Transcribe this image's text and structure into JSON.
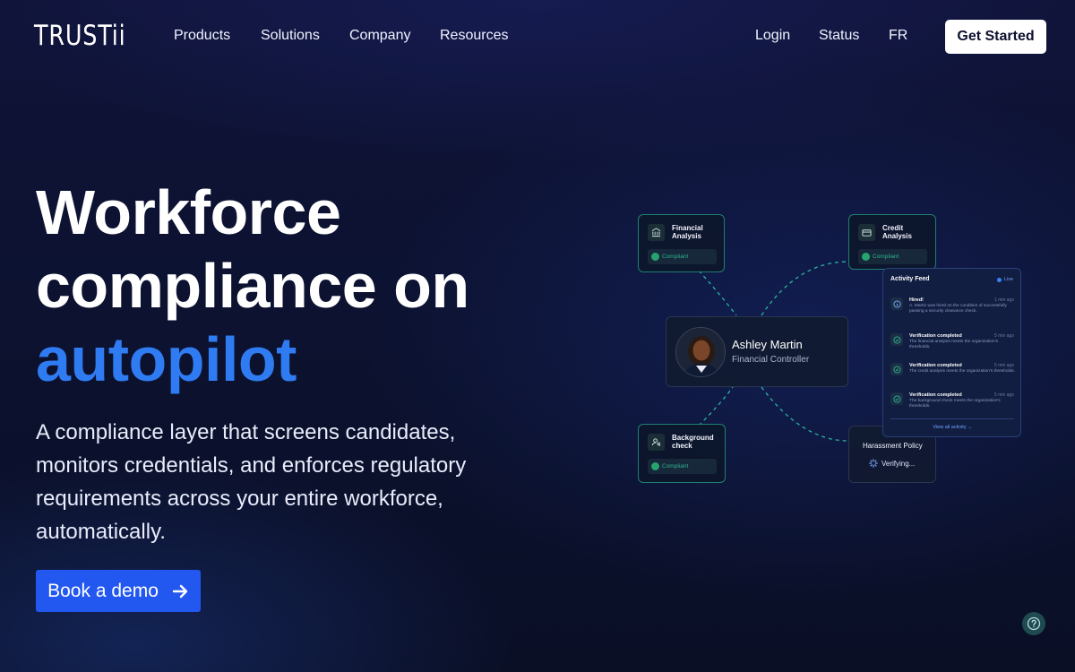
{
  "nav": {
    "logo": "TRUSTii",
    "links": [
      "Products",
      "Solutions",
      "Company",
      "Resources"
    ],
    "right_links": [
      "Login",
      "Status",
      "FR"
    ],
    "cta": "Get Started"
  },
  "hero": {
    "title_line1": "Workforce",
    "title_line2": "compliance on",
    "title_accent": "autopilot",
    "subtitle": "A compliance layer that screens candidates, monitors credentials, and enforces regulatory requirements across your entire workforce, automatically.",
    "cta": "Book a demo"
  },
  "illustration": {
    "cards": [
      {
        "label": "Financial Analysis",
        "status": "Compliant",
        "icon": "bank-icon"
      },
      {
        "label": "Credit Analysis",
        "status": "Compliant",
        "icon": "credit-card-icon"
      },
      {
        "label": "Background check",
        "status": "Compliant",
        "icon": "person-search-icon"
      }
    ],
    "person": {
      "name": "Ashley Martin",
      "role": "Financial Controller"
    },
    "policy": {
      "title": "Harassment Policy",
      "status": "Verifying..."
    },
    "feed": {
      "title": "Activity Feed",
      "live": "Live",
      "items": [
        {
          "head": "Hired!",
          "time": "1 min ago",
          "body": "A. Martin was hired on the condition of successfully passing a security clearance check."
        },
        {
          "head": "Verification completed",
          "time": "5 min ago",
          "body": "The financial analysis meets the organization's thresholds."
        },
        {
          "head": "Verification completed",
          "time": "5 min ago",
          "body": "The credit analysis meets the organization's thresholds."
        },
        {
          "head": "Verification completed",
          "time": "5 min ago",
          "body": "The background check meets the organization's thresholds."
        }
      ],
      "link": "View all activity →"
    }
  },
  "colors": {
    "accent": "#2f7bf2",
    "button": "#2358f0",
    "compliant": "#26a36f",
    "card_border": "#1f7f70"
  }
}
